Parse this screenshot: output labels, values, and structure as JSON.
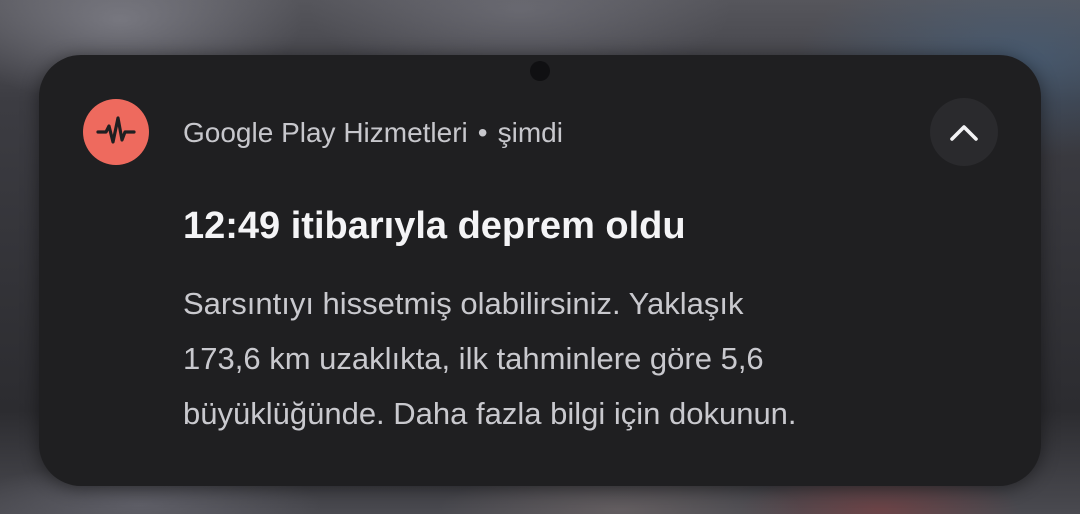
{
  "notification": {
    "app_name": "Google Play Hizmetleri",
    "separator": "•",
    "time": "şimdi",
    "app_icon": "earthquake-waveform-icon",
    "collapse_icon": "chevron-up-icon",
    "title": "12:49 itibarıyla deprem oldu",
    "body_lines": [
      "Sarsıntıyı hissetmiş olabilirsiniz. Yaklaşık",
      "173,6 km uzaklıkta, ilk tahminlere göre 5,6",
      "büyüklüğünde. Daha fazla bilgi için dokunun."
    ]
  },
  "colors": {
    "accent": "#ee6a5e",
    "card_background": "#1f1f21",
    "title_text": "#f4f4f6",
    "secondary_text": "#c9c9ce"
  }
}
